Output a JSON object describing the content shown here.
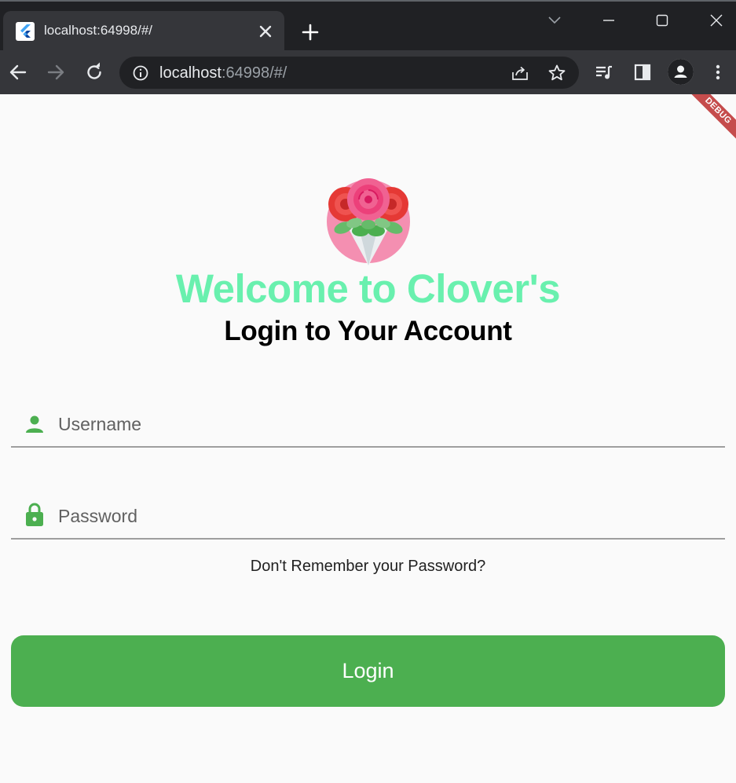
{
  "browser": {
    "tab": {
      "title": "localhost:64998/#/",
      "favicon": "flutter-icon"
    },
    "address": {
      "host": "localhost",
      "path": ":64998/#/"
    },
    "icons": {
      "back": "back-arrow-icon",
      "forward": "forward-arrow-icon",
      "reload": "reload-icon",
      "site_info": "info-icon",
      "share": "share-icon",
      "bookmark": "star-icon",
      "media": "media-queue-icon",
      "side_panel": "side-panel-icon",
      "profile": "profile-icon",
      "menu": "kebab-menu-icon"
    }
  },
  "app": {
    "debug_banner": "DEBUG",
    "logo_icon": "rose-bouquet-icon",
    "welcome_title": "Welcome to Clover's",
    "subtitle": "Login to Your Account",
    "username": {
      "placeholder": "Username",
      "value": "",
      "icon": "person-icon"
    },
    "password": {
      "placeholder": "Password",
      "value": "",
      "icon": "lock-icon"
    },
    "forgot_link": "Don't Remember your Password?",
    "login_button": "Login",
    "colors": {
      "accent_green": "#4caf50",
      "title_green": "#69f0ae",
      "debug_red": "#b71c1c"
    }
  }
}
